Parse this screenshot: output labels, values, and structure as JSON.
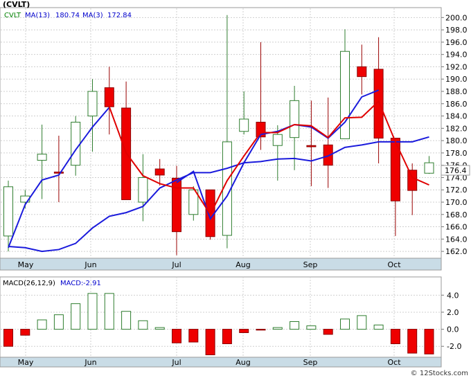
{
  "chart_data": [
    {
      "type": "candlestick",
      "title": "(CVLT)",
      "legend": [
        {
          "label": "CVLT",
          "color": "#008000"
        },
        {
          "label": "MA(13)",
          "value": "180.74",
          "color": "#0000cc"
        },
        {
          "label": "MA(3)",
          "value": "172.84",
          "color": "#0000cc"
        }
      ],
      "last_price_label": "176.4",
      "ylim": [
        161,
        201.5
      ],
      "y_ticks": [
        "162.0",
        "164.0",
        "166.0",
        "168.0",
        "170.0",
        "172.0",
        "174.0",
        "176.0",
        "178.0",
        "180.0",
        "182.0",
        "184.0",
        "186.0",
        "188.0",
        "190.0",
        "192.0",
        "194.0",
        "196.0",
        "198.0",
        "200.0"
      ],
      "x_labels": [
        "May",
        "Jun",
        "Jul",
        "Aug",
        "Sep",
        "Oct"
      ],
      "candles": [
        {
          "open": 164.5,
          "close": 172.5,
          "high": 173.5,
          "low": 162.0,
          "up": true
        },
        {
          "open": 170.0,
          "close": 171.0,
          "high": 172.0,
          "low": 169.0,
          "up": true
        },
        {
          "open": 176.8,
          "close": 177.8,
          "high": 182.6,
          "low": 170.5,
          "up": true
        },
        {
          "open": 174.9,
          "close": 174.7,
          "high": 180.8,
          "low": 170.0,
          "up": false
        },
        {
          "open": 176.0,
          "close": 183.0,
          "high": 184.0,
          "low": 174.3,
          "up": true
        },
        {
          "open": 184.0,
          "close": 188.0,
          "high": 190.0,
          "low": 178.2,
          "up": true
        },
        {
          "open": 188.6,
          "close": 185.5,
          "high": 192.0,
          "low": 181.0,
          "up": false
        },
        {
          "open": 185.3,
          "close": 170.4,
          "high": 189.6,
          "low": 170.4,
          "up": false
        },
        {
          "open": 170.0,
          "close": 174.0,
          "high": 177.8,
          "low": 166.9,
          "up": true
        },
        {
          "open": 175.4,
          "close": 174.4,
          "high": 177.0,
          "low": 172.7,
          "up": false
        },
        {
          "open": 173.9,
          "close": 165.2,
          "high": 175.9,
          "low": 161.4,
          "up": false
        },
        {
          "open": 168.0,
          "close": 172.0,
          "high": 172.6,
          "low": 167.0,
          "up": true
        },
        {
          "open": 172.0,
          "close": 164.4,
          "high": 172.0,
          "low": 163.9,
          "up": false
        },
        {
          "open": 164.6,
          "close": 179.8,
          "high": 200.4,
          "low": 162.5,
          "up": true
        },
        {
          "open": 181.5,
          "close": 183.5,
          "high": 188.0,
          "low": 181.0,
          "up": true
        },
        {
          "open": 183.0,
          "close": 180.6,
          "high": 196.0,
          "low": 178.5,
          "up": false
        },
        {
          "open": 179.2,
          "close": 181.0,
          "high": 182.5,
          "low": 173.5,
          "up": true
        },
        {
          "open": 180.5,
          "close": 186.5,
          "high": 188.9,
          "low": 175.2,
          "up": true
        },
        {
          "open": 179.2,
          "close": 179.0,
          "high": 186.5,
          "low": 172.6,
          "up": false
        },
        {
          "open": 179.3,
          "close": 176.0,
          "high": 187.0,
          "low": 172.3,
          "up": false
        },
        {
          "open": 180.3,
          "close": 194.5,
          "high": 198.1,
          "low": 180.3,
          "up": true
        },
        {
          "open": 192.0,
          "close": 190.4,
          "high": 195.6,
          "low": 187.5,
          "up": false
        },
        {
          "open": 191.6,
          "close": 180.4,
          "high": 196.8,
          "low": 176.3,
          "up": false
        },
        {
          "open": 180.4,
          "close": 170.2,
          "high": 180.4,
          "low": 164.5,
          "up": false
        },
        {
          "open": 175.2,
          "close": 171.9,
          "high": 176.3,
          "low": 167.9,
          "up": false
        },
        {
          "open": 174.7,
          "close": 176.4,
          "high": 177.5,
          "low": 174.6,
          "up": true
        }
      ],
      "ma13": [
        [
          0,
          162.6
        ],
        [
          1,
          169.6
        ],
        [
          2,
          173.6
        ],
        [
          3,
          174.4
        ],
        [
          4,
          178.5
        ],
        [
          5,
          182.2
        ],
        [
          6,
          185.4
        ],
        [
          10,
          173.2
        ],
        [
          11,
          175.0
        ],
        [
          12,
          167.3
        ],
        [
          13,
          171.0
        ],
        [
          14,
          176.4
        ],
        [
          15,
          181.0
        ],
        [
          16,
          181.5
        ],
        [
          17,
          182.6
        ],
        [
          18,
          182.2
        ],
        [
          19,
          180.4
        ],
        [
          20,
          183.0
        ],
        [
          21,
          187.1
        ],
        [
          22,
          188.2
        ]
      ],
      "ma3": [
        [
          0,
          162.8
        ],
        [
          1,
          162.6
        ],
        [
          2,
          162.0
        ],
        [
          3,
          162.3
        ],
        [
          4,
          163.3
        ],
        [
          5,
          165.8
        ],
        [
          6,
          167.7
        ],
        [
          7,
          168.3
        ],
        [
          8,
          169.3
        ],
        [
          9,
          172.3
        ],
        [
          10,
          173.6
        ],
        [
          11,
          174.8
        ],
        [
          12,
          174.8
        ],
        [
          13,
          175.5
        ],
        [
          14,
          176.4
        ],
        [
          15,
          176.6
        ],
        [
          16,
          177.0
        ],
        [
          17,
          177.1
        ],
        [
          18,
          176.7
        ],
        [
          19,
          177.5
        ],
        [
          20,
          178.9
        ],
        [
          21,
          179.3
        ],
        [
          22,
          179.8
        ],
        [
          23,
          179.8
        ],
        [
          24,
          179.8
        ],
        [
          25,
          180.6
        ]
      ],
      "ma3_red": [
        [
          6,
          185.5
        ],
        [
          7,
          178.0
        ],
        [
          8,
          174.3
        ],
        [
          9,
          173.0
        ],
        [
          10,
          172.3
        ],
        [
          11,
          172.3
        ],
        [
          12,
          168.0
        ],
        [
          13,
          173.5
        ],
        [
          14,
          177.5
        ],
        [
          15,
          181.3
        ],
        [
          16,
          181.3
        ],
        [
          17,
          182.6
        ],
        [
          18,
          182.4
        ],
        [
          19,
          180.5
        ],
        [
          20,
          183.7
        ],
        [
          21,
          183.8
        ],
        [
          22,
          186.4
        ],
        [
          23,
          179.8
        ],
        [
          24,
          174.0
        ],
        [
          25,
          172.8
        ]
      ]
    },
    {
      "type": "bar",
      "title": "MACD(26,12,9)",
      "legend": [
        {
          "label": "MACD(26,12,9)",
          "color": "#000000"
        },
        {
          "label": "MACD:",
          "value": "-2.91",
          "color": "#0000cc"
        }
      ],
      "ylim": [
        -3.2,
        5.0
      ],
      "y_ticks": [
        "-2.0",
        "0.0",
        "2.0",
        "4.0"
      ],
      "x_labels": [
        "May",
        "Jun",
        "Jul",
        "Aug",
        "Sep",
        "Oct"
      ],
      "values": [
        -2.0,
        -0.7,
        1.1,
        1.7,
        3.0,
        4.2,
        4.2,
        2.1,
        1.0,
        0.2,
        -1.6,
        -1.5,
        -3.0,
        -1.7,
        -0.4,
        -0.1,
        0.2,
        0.9,
        0.4,
        -0.6,
        1.2,
        1.6,
        0.5,
        -1.7,
        -2.8,
        -2.9
      ]
    }
  ],
  "watermark": "© 12Stocks.com"
}
